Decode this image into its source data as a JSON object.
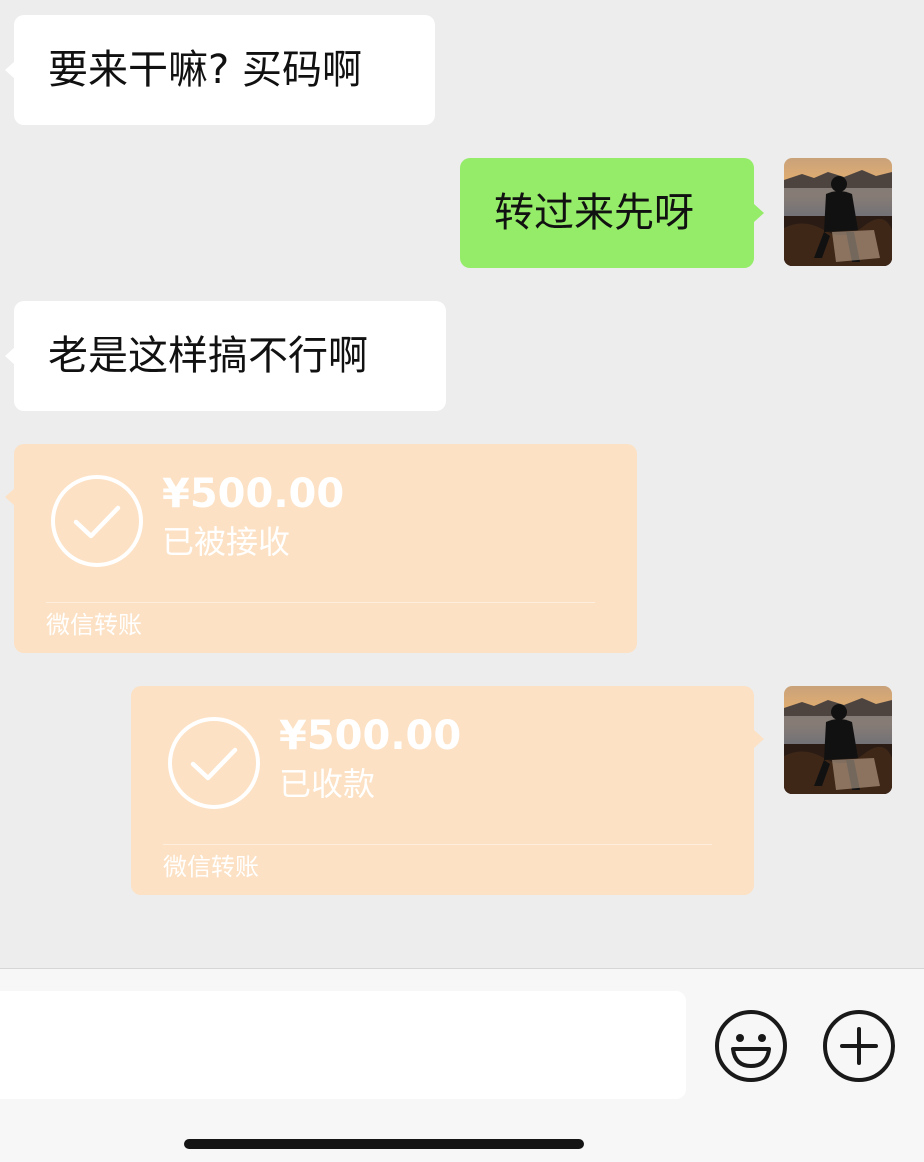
{
  "messages": [
    {
      "side": "left",
      "text": "要来干嘛? 买码啊"
    },
    {
      "side": "right",
      "text": "转过来先呀"
    },
    {
      "side": "left",
      "text": "老是这样搞不行啊"
    }
  ],
  "transfers": [
    {
      "side": "left",
      "amount": "¥500.00",
      "status": "已被接收",
      "footer": "微信转账"
    },
    {
      "side": "right",
      "amount": "¥500.00",
      "status": "已收款",
      "footer": "微信转账"
    }
  ],
  "input_bar": {
    "input_value": "",
    "emoji_icon": "smiley-face-icon",
    "more_icon": "plus-circle-icon"
  },
  "colors": {
    "background": "#ededed",
    "incoming_bubble": "#ffffff",
    "outgoing_bubble": "#95ec69",
    "transfer_card": "#fce1c4"
  }
}
